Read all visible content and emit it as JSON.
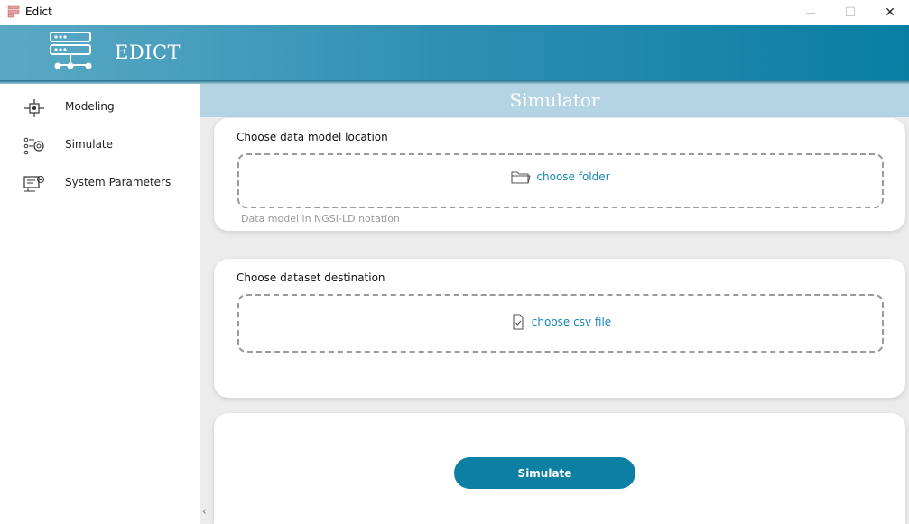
{
  "window": {
    "title": "Edict",
    "minimize_glyph": "—",
    "maximize_glyph": "☐",
    "close_glyph": "✕"
  },
  "header": {
    "app_name": "EDICT",
    "logo_icon": "server-network-icon"
  },
  "sidebar": {
    "items": [
      {
        "label": "Modeling",
        "icon": "modeling-icon"
      },
      {
        "label": "Simulate",
        "icon": "simulate-icon"
      },
      {
        "label": "System Parameters",
        "icon": "system-parameters-icon"
      }
    ]
  },
  "main": {
    "banner_title": "Simulator",
    "data_model": {
      "title": "Choose data model location",
      "dropzone_label": "choose folder",
      "dropzone_icon": "folder-icon",
      "helper": "Data model in NGSI-LD notation"
    },
    "dataset": {
      "title": "Choose dataset destination",
      "dropzone_label": "choose csv file",
      "dropzone_icon": "file-icon"
    },
    "simulate_button": "Simulate",
    "scroll_glyph": "‹"
  },
  "colors": {
    "accent": "#0c7fa3",
    "banner": "#b4d4e4",
    "link": "#1688b0"
  }
}
